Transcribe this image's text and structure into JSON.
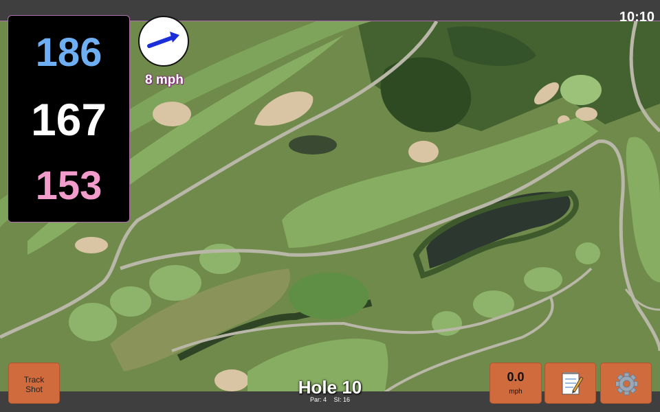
{
  "status": {
    "time": "10:10"
  },
  "distances": {
    "back": "186",
    "center": "167",
    "front": "153"
  },
  "wind": {
    "speed": "8 mph",
    "icon": "arrow-icon",
    "direction": "east-northeast"
  },
  "buttons": {
    "track_shot": [
      "Track",
      "Shot"
    ],
    "speed_value": "0.0",
    "speed_unit": "mph",
    "notes_icon": "notepad-icon",
    "settings_icon": "gear-icon"
  },
  "hole": {
    "title": "Hole 10",
    "par": "Par: 4",
    "si": "SI: 16"
  },
  "colors": {
    "back": "#6eaef2",
    "center": "#ffffff",
    "front": "#f29ccc",
    "button": "#d06b3e",
    "bar": "#3f3f3f",
    "accent": "#b070b0"
  }
}
